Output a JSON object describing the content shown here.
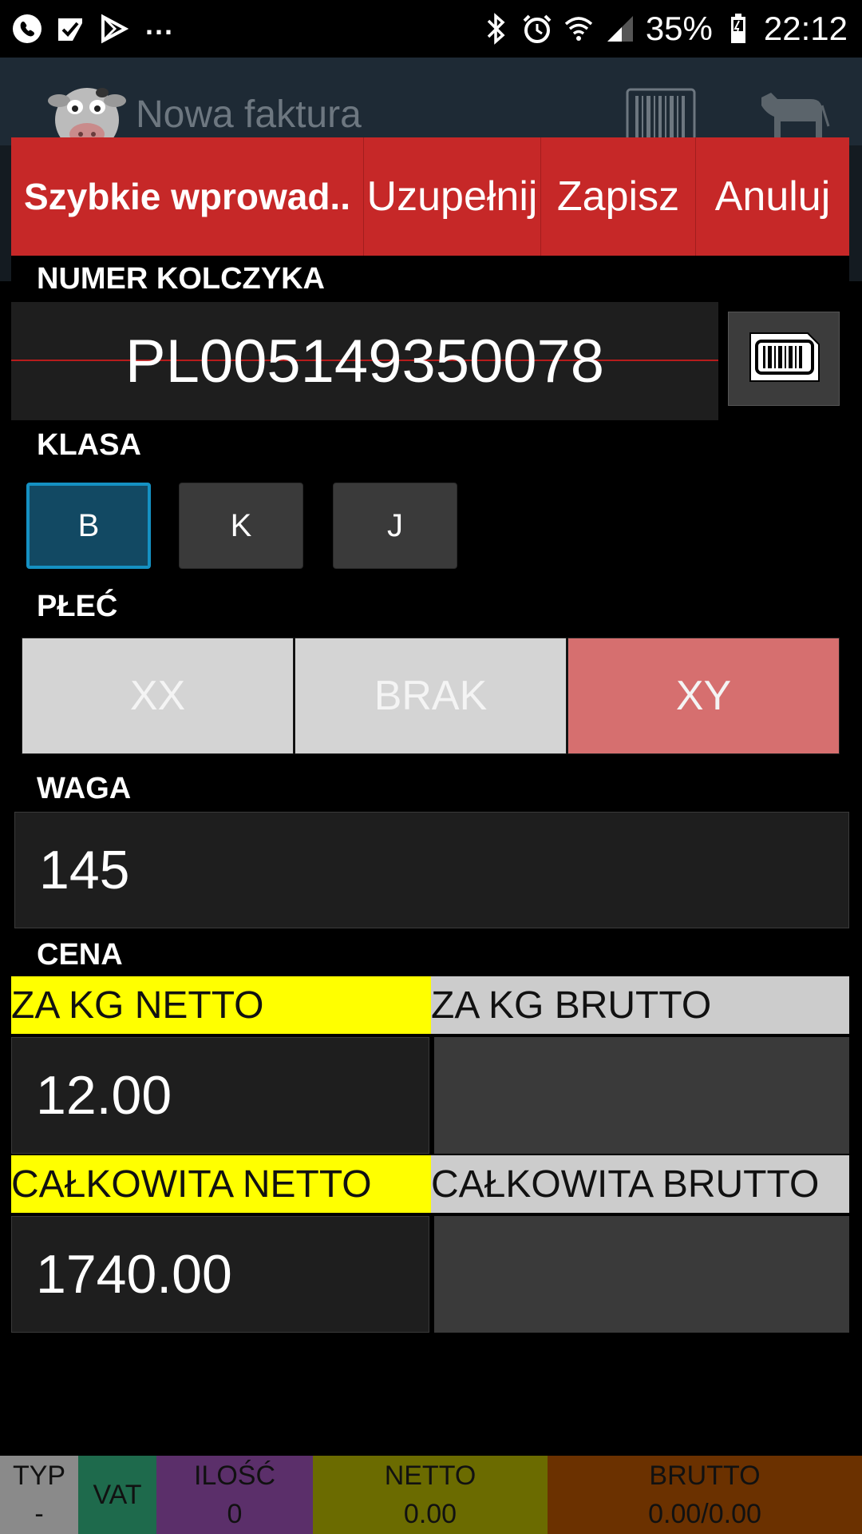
{
  "status_bar": {
    "overflow": "...",
    "battery": "35%",
    "time": "22:12"
  },
  "action_bar": {
    "title": "Nowa faktura"
  },
  "dialog": {
    "toolbar": {
      "quick_entry": "Szybkie wprowad..",
      "fill": "Uzupełnij",
      "save": "Zapisz",
      "cancel": "Anuluj"
    },
    "tag": {
      "label": "NUMER KOLCZYKA",
      "value": "PL005149350078"
    },
    "class": {
      "label": "KLASA",
      "options": [
        "B",
        "K",
        "J"
      ],
      "selected": "B"
    },
    "sex": {
      "label": "PŁEĆ",
      "options": [
        "XX",
        "BRAK",
        "XY"
      ],
      "selected": "XY"
    },
    "weight": {
      "label": "WAGA",
      "value": "145"
    },
    "price": {
      "label": "CENA",
      "per_kg_net_label": "ZA KG NETTO",
      "per_kg_gross_label": "ZA KG BRUTTO",
      "per_kg_net_value": "12.00",
      "per_kg_gross_value": "",
      "total_net_label": "CAŁKOWITA NETTO",
      "total_gross_label": "CAŁKOWITA BRUTTO",
      "total_net_value": "1740.00",
      "total_gross_value": ""
    }
  },
  "footer": {
    "typ_label": "TYP",
    "typ_value": "-",
    "vat_label": "VAT",
    "vat_value": "",
    "qty_label": "ILOŚĆ",
    "qty_value": "0",
    "net_label": "NETTO",
    "net_value": "0.00",
    "gross_label": "BRUTTO",
    "gross_value": "0.00/0.00"
  },
  "colors": {
    "toolbar": "#c62828",
    "selected_class": "#124963",
    "selected_sex": "#d66f6f",
    "net_header": "#ffff00",
    "gross_header": "#cccccc"
  },
  "icons": [
    "phone-icon",
    "download-check-icon",
    "play-store-icon",
    "bluetooth-icon",
    "alarm-icon",
    "wifi-icon",
    "signal-icon",
    "battery-charging-icon",
    "cow-logo-icon",
    "barcode-icon",
    "cow-icon",
    "barcode-scan-icon"
  ]
}
